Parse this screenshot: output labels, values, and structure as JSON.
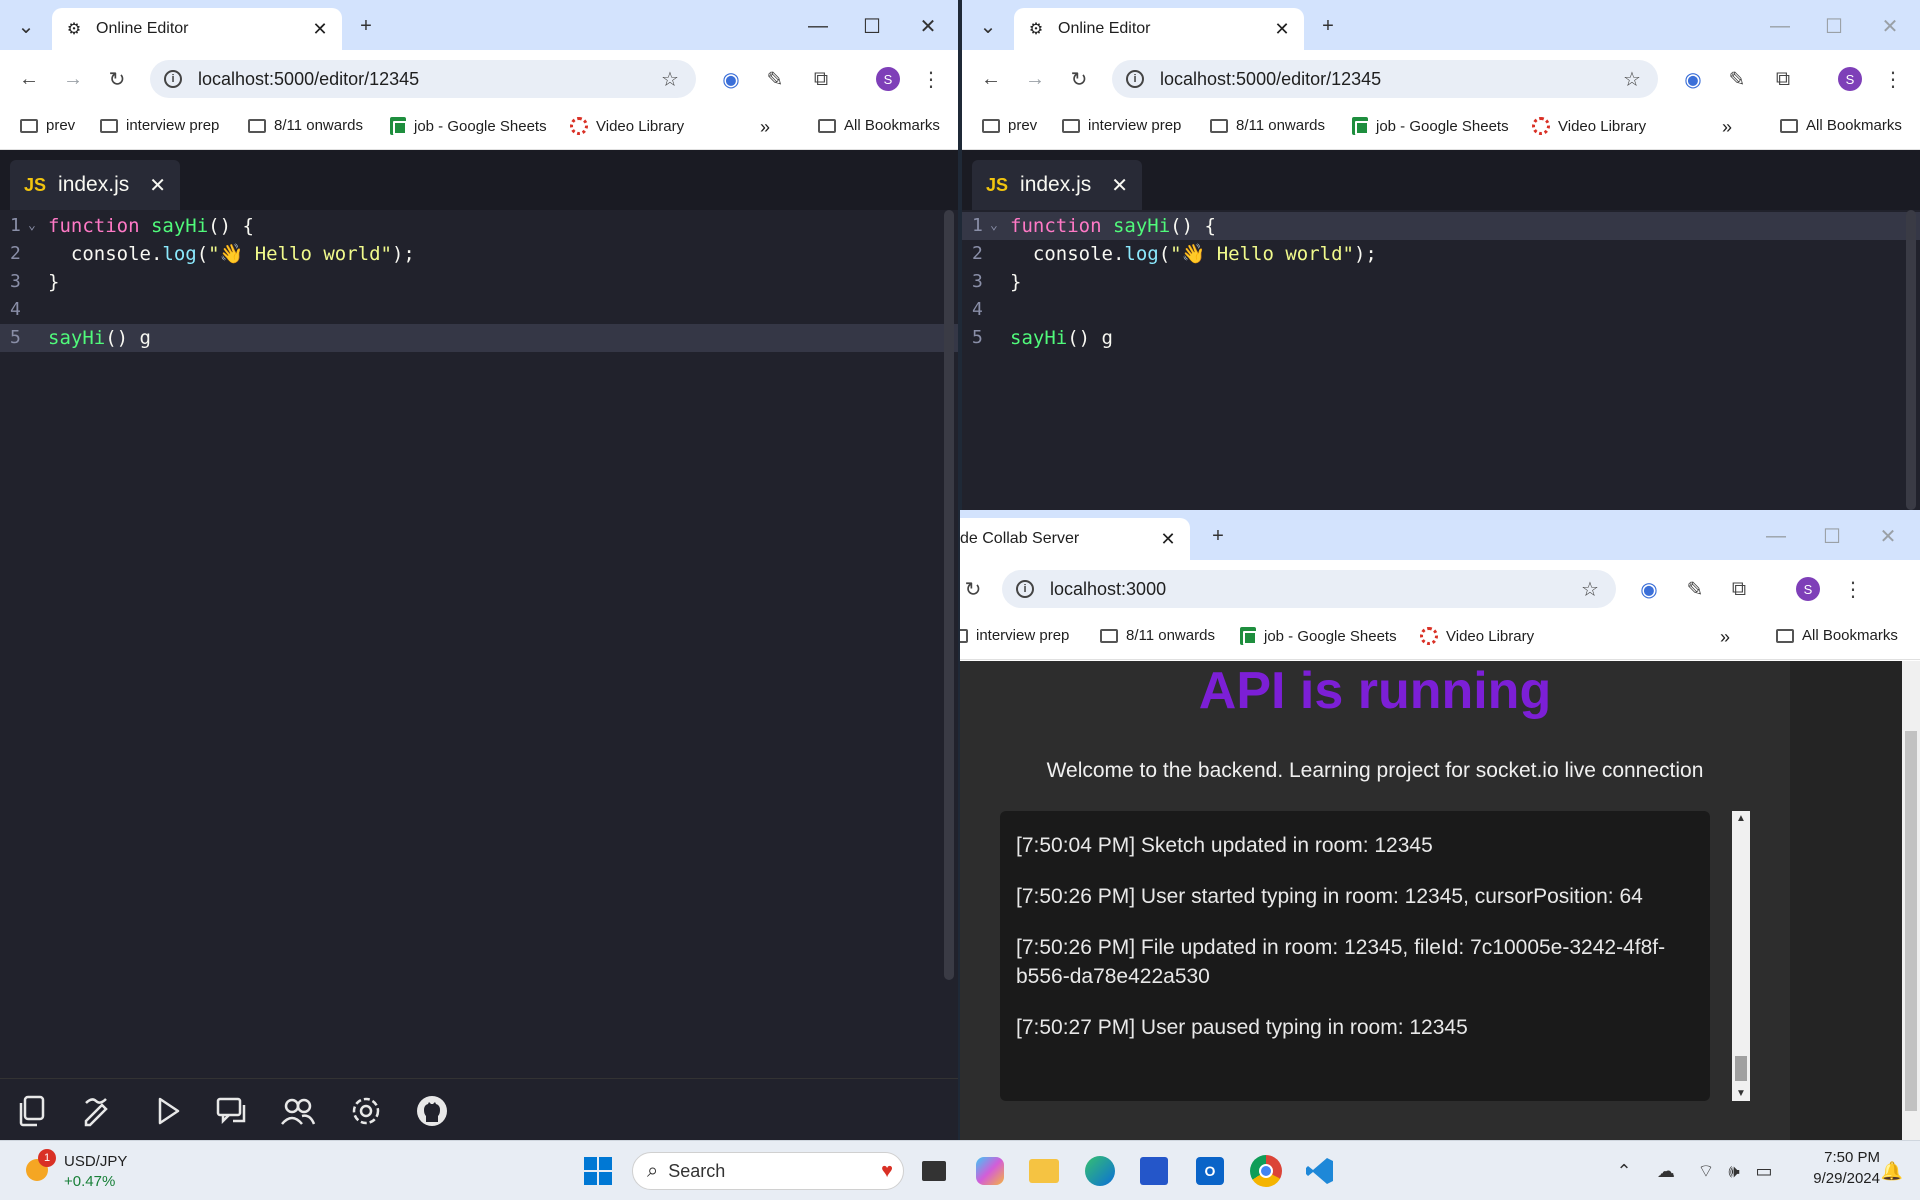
{
  "left_browser": {
    "tab_title": "Online Editor",
    "url": "localhost:5000/editor/12345",
    "bookmarks": [
      "prev",
      "interview prep",
      "8/11 onwards",
      "job - Google Sheets",
      "Video Library"
    ],
    "all_bookmarks": "All Bookmarks",
    "more": "»",
    "avatar": "S"
  },
  "right_top_browser": {
    "tab_title": "Online Editor",
    "url": "localhost:5000/editor/12345",
    "bookmarks": [
      "prev",
      "interview prep",
      "8/11 onwards",
      "job - Google Sheets",
      "Video Library"
    ],
    "all_bookmarks": "All Bookmarks",
    "more": "»",
    "avatar": "S"
  },
  "right_bottom_browser": {
    "tab_title": "de Collab Server",
    "url": "localhost:3000",
    "bookmarks": [
      "interview prep",
      "8/11 onwards",
      "job - Google Sheets",
      "Video Library"
    ],
    "all_bookmarks": "All Bookmarks",
    "more": "»",
    "avatar": "S"
  },
  "editor": {
    "file_tab": "index.js",
    "file_badge": "JS",
    "line_numbers": [
      "1",
      "2",
      "3",
      "4",
      "5"
    ],
    "lines": {
      "l1_kw": "function",
      "l1_fn": "sayHi",
      "l1_rest": "() {",
      "l2_a": "  console.",
      "l2_prop": "log",
      "l2_b": "(",
      "l2_str": "\"👋 Hello world\"",
      "l2_c": ");",
      "l3": "}",
      "l5_fn": "sayHi",
      "l5_rest": "() g"
    }
  },
  "api_page": {
    "heading": "API is running",
    "subtitle": "Welcome to the backend. Learning project for socket.io live connection",
    "logs": [
      "[7:50:04 PM] Sketch updated in room: 12345",
      "[7:50:26 PM] User started typing in room: 12345, cursorPosition: 64",
      "[7:50:26 PM] File updated in room: 12345, fileId: 7c10005e-3242-4f8f-b556-da78e422a530",
      "[7:50:27 PM] User paused typing in room: 12345"
    ]
  },
  "taskbar": {
    "ticker_name": "USD/JPY",
    "ticker_change": "+0.47%",
    "ticker_badge": "1",
    "search_placeholder": "Search",
    "time": "7:50 PM",
    "date": "9/29/2024"
  },
  "colors": {
    "editor_bg": "#21222c",
    "keyword": "#ff79c6",
    "function": "#50fa7b",
    "string": "#f1fa8c",
    "api_heading": "#7c1fd6"
  }
}
